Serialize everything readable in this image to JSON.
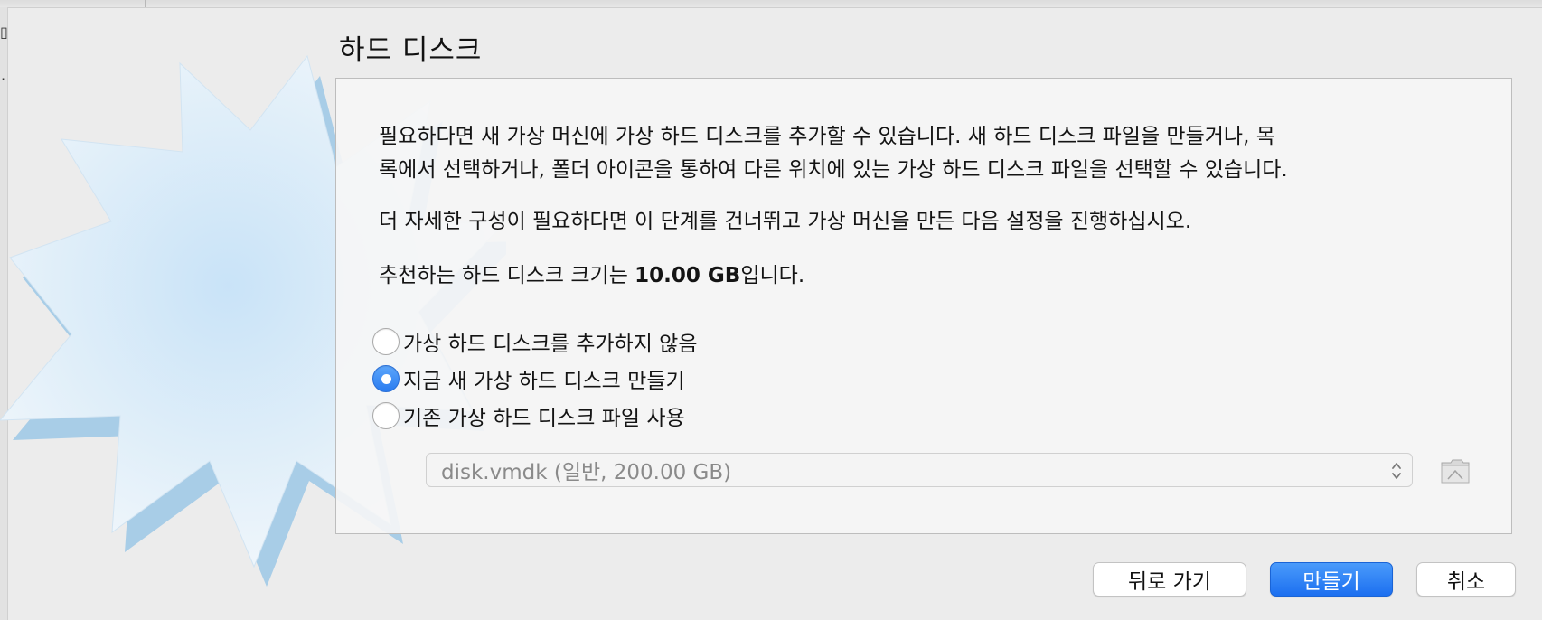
{
  "dialog": {
    "title": "하드 디스크",
    "description_line1": "필요하다면 새 가상 머신에 가상 하드 디스크를 추가할 수 있습니다. 새 하드 디스크 파일을 만들거나, 목",
    "description_line2": "록에서 선택하거나, 폴더 아이콘을 통하여 다른 위치에 있는 가상 하드 디스크 파일을 선택할 수 있습니다.",
    "config_hint": "더 자세한 구성이 필요하다면 이 단계를 건너뛰고 가상 머신을 만든 다음 설정을 진행하십시오.",
    "recommend_prefix": "추천하는 하드 디스크 크기는 ",
    "recommend_size": "10.00 GB",
    "recommend_suffix": "입니다."
  },
  "options": [
    {
      "label": "가상 하드 디스크를 추가하지 않음",
      "selected": false
    },
    {
      "label": "지금 새 가상 하드 디스크 만들기",
      "selected": true
    },
    {
      "label": "기존 가상 하드 디스크 파일 사용",
      "selected": false
    }
  ],
  "disk_select": {
    "value": "disk.vmdk (일반, 200.00 GB)",
    "enabled": false
  },
  "icons": {
    "dropdown": "chevron-up-down-icon",
    "folder": "folder-icon",
    "illustration": "starburst-icon"
  },
  "buttons": {
    "back": "뒤로 가기",
    "create": "만들기",
    "cancel": "취소"
  },
  "colors": {
    "accent": "#2a7cf0",
    "background": "#ececec"
  }
}
